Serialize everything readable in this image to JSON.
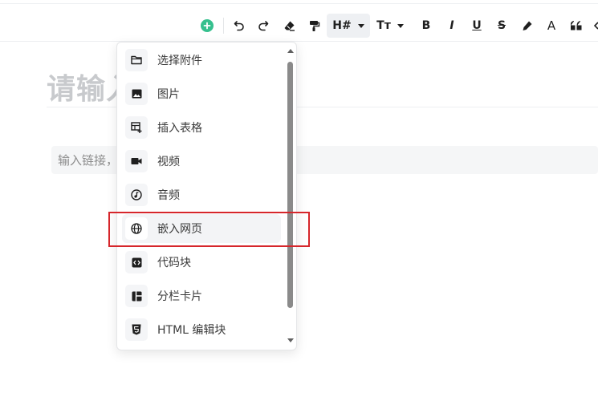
{
  "toolbar": {
    "buttons": [
      {
        "name": "add-block",
        "icon": "plus-circle-icon",
        "color": "#36c08e"
      },
      {
        "name": "undo",
        "icon": "undo-icon"
      },
      {
        "name": "redo",
        "icon": "redo-icon"
      },
      {
        "name": "clear-format",
        "icon": "eraser-icon"
      },
      {
        "name": "format-painter",
        "icon": "paint-roller-icon"
      },
      {
        "name": "heading",
        "label": "H#",
        "icon": "caret-down-icon"
      },
      {
        "name": "font-size",
        "label": "Tт",
        "icon": "caret-down-icon"
      },
      {
        "name": "bold",
        "label": "B"
      },
      {
        "name": "italic",
        "label": "I"
      },
      {
        "name": "underline",
        "label": "U"
      },
      {
        "name": "strikethrough",
        "label": "S"
      },
      {
        "name": "highlight",
        "icon": "highlighter-pen-icon"
      },
      {
        "name": "font-color",
        "label": "A"
      },
      {
        "name": "quote",
        "icon": "quote-icon"
      }
    ]
  },
  "editor": {
    "title_placeholder": "请输入",
    "link_placeholder": "输入链接，"
  },
  "insert_menu": {
    "items": [
      {
        "label": "选择附件",
        "icon": "folder-icon"
      },
      {
        "label": "图片",
        "icon": "image-icon"
      },
      {
        "label": "插入表格",
        "icon": "table-add-icon"
      },
      {
        "label": "视频",
        "icon": "video-camera-icon"
      },
      {
        "label": "音频",
        "icon": "music-note-icon"
      },
      {
        "label": "嵌入网页",
        "icon": "globe-icon",
        "active": true
      },
      {
        "label": "代码块",
        "icon": "code-block-icon"
      },
      {
        "label": "分栏卡片",
        "icon": "columns-icon"
      },
      {
        "label": "HTML 编辑块",
        "icon": "html5-icon"
      }
    ]
  },
  "colors": {
    "accent": "#36c08e",
    "highlight_border": "#d6262b"
  }
}
